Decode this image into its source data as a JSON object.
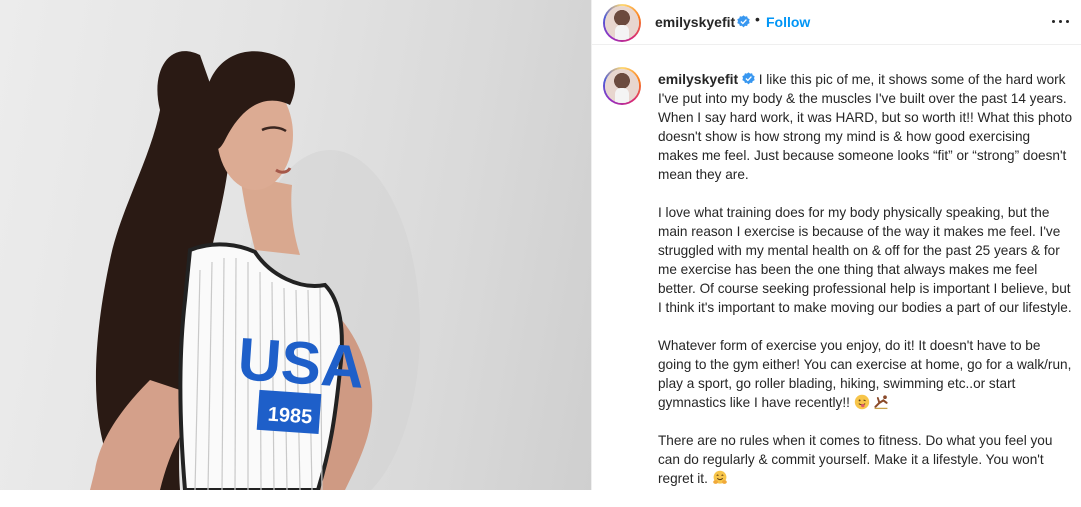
{
  "post": {
    "username": "emilyskyefit",
    "follow_label": "Follow",
    "separator": "•",
    "paragraphs": [
      "I like this pic of me, it shows some of the hard work I've put into my body & the muscles I've built over the past 14 years. When I say hard work, it was HARD, but so worth it!! What this photo doesn't show is how strong my mind is & how good exercising makes me feel. Just because someone looks “fit” or “strong” doesn't mean they are.",
      "I love what training does for my body physically speaking, but the main reason I exercise is because of the way it makes me feel. I've struggled with my mental health on & off for the past 25 years & for me exercise has been the one thing that always makes me feel better. Of course seeking professional help is important I believe, but I think it's important to make moving our bodies a part of our lifestyle.",
      "Whatever form of exercise you enjoy, do it! It doesn't have to be going to the gym either! You can exercise at home, go for a walk/run, play a sport, go roller blading, hiking, swimming etc..or start gymnastics like I have recently!!",
      "There are no rules when it comes to fitness. Do what you feel you can do regularly & commit yourself. Make it a lifestyle. You won't regret it."
    ],
    "emojis": {
      "p3": [
        "tongue-out-face-emoji",
        "gymnastics-emoji"
      ],
      "p4": [
        "hugging-face-emoji"
      ]
    }
  },
  "photo": {
    "shirt_text": "USA",
    "shirt_number": "1985"
  },
  "colors": {
    "link_blue": "#0095f6",
    "verified_blue": "#3897f0",
    "text": "#262626",
    "shirt_blue": "#1e5fc9"
  }
}
